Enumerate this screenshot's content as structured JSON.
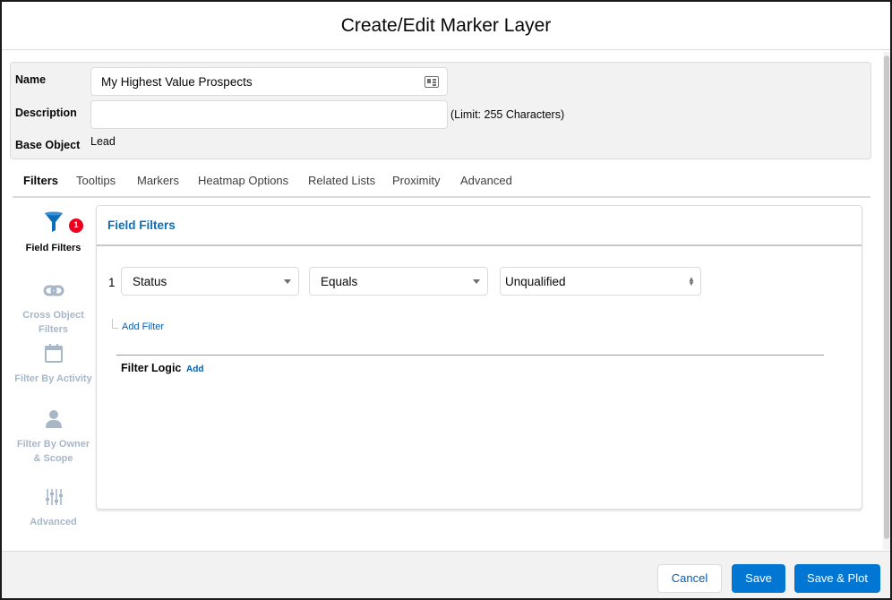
{
  "modal": {
    "title": "Create/Edit Marker Layer"
  },
  "form": {
    "name_label": "Name",
    "name_value": "My Highest Value Prospects",
    "description_label": "Description",
    "description_value": "",
    "description_limit": "(Limit: 255 Characters)",
    "base_object_label": "Base Object",
    "base_object_value": "Lead"
  },
  "tabs": [
    {
      "label": "Filters",
      "active": true
    },
    {
      "label": "Tooltips",
      "active": false
    },
    {
      "label": "Markers",
      "active": false
    },
    {
      "label": "Heatmap Options",
      "active": false
    },
    {
      "label": "Related Lists",
      "active": false
    },
    {
      "label": "Proximity",
      "active": false
    },
    {
      "label": "Advanced",
      "active": false
    }
  ],
  "sidebar": {
    "items": [
      {
        "label": "Field Filters",
        "icon": "funnel-icon",
        "badge": "1",
        "active": true
      },
      {
        "label": "Cross Object Filters",
        "icon": "link-icon",
        "active": false
      },
      {
        "label": "Filter By Activity",
        "icon": "calendar-icon",
        "active": false
      },
      {
        "label": "Filter By Owner & Scope",
        "icon": "user-icon",
        "active": false
      },
      {
        "label": "Advanced",
        "icon": "sliders-icon",
        "active": false
      }
    ]
  },
  "field_filters": {
    "title": "Field Filters",
    "rows": [
      {
        "number": "1",
        "field": "Status",
        "operator": "Equals",
        "value": "Unqualified"
      }
    ],
    "add_filter": "Add Filter",
    "filter_logic_label": "Filter Logic",
    "filter_logic_add": "Add"
  },
  "footer": {
    "cancel": "Cancel",
    "save": "Save",
    "save_plot": "Save & Plot"
  },
  "colors": {
    "brand": "#0176d3",
    "link": "#0b5cab",
    "card_title": "#0b6fb8",
    "badge": "#ea001e",
    "inactive_sidebar": "#a8b7c7"
  }
}
